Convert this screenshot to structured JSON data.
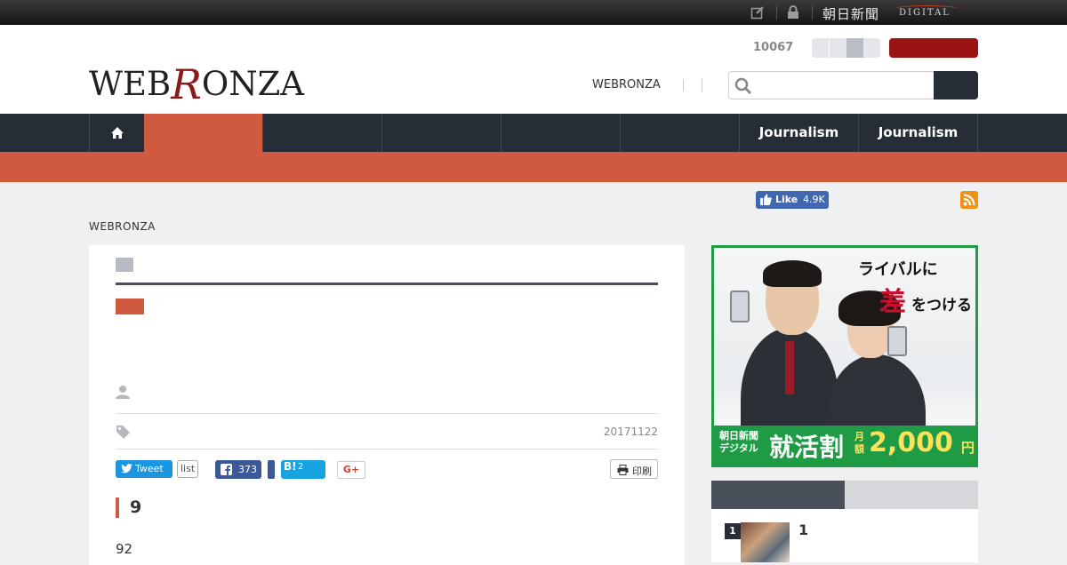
{
  "topbar": {
    "edit_icon": "edit-icon",
    "lock_icon": "lock-icon",
    "brand": "朝日新聞",
    "brand_sub": "DIGITAL"
  },
  "header": {
    "logo_prefix": "WEB",
    "logo_r": "R",
    "logo_suffix": "ONZA",
    "count": "10067",
    "link": "WEBRONZA",
    "search_placeholder": ""
  },
  "nav": {
    "items": [
      {
        "label": "",
        "icon": "home-icon"
      },
      {
        "label": ""
      },
      {
        "label": ""
      },
      {
        "label": ""
      },
      {
        "label": ""
      },
      {
        "label": ""
      },
      {
        "label": "Journalism"
      }
    ]
  },
  "social": {
    "fb_like_label": "Like",
    "fb_like_count": "4.9K",
    "rss_icon": "rss-icon"
  },
  "breadcrumb": "WEBRONZA",
  "article": {
    "date": "20171122",
    "share": {
      "tweet_label": "Tweet",
      "tweet_count": "list",
      "fb_share_count": "373",
      "hatena_label": "B!",
      "hatena_count": "2",
      "gplus_label": "G+",
      "print_label": "印刷"
    },
    "section_heading": "9",
    "body_text": "92"
  },
  "ad": {
    "headline_1": "ライバルに",
    "headline_2": "差",
    "headline_2b": "をつける",
    "band_brand": "朝日新聞\nデジタル",
    "band_title": "就活割",
    "band_month": "月\n額",
    "band_price": "2,000",
    "band_unit": "円",
    "colors": {
      "border": "#1f9b45",
      "accent": "#c8102e",
      "price": "#ffe15a"
    }
  },
  "ranking": {
    "items": [
      {
        "rank": "1",
        "title": "1"
      }
    ]
  },
  "colors": {
    "nav_bg": "#262d37",
    "accent_orange": "#d05a3f",
    "brand_red": "#9a1414",
    "page_bg": "#eff0f2"
  }
}
